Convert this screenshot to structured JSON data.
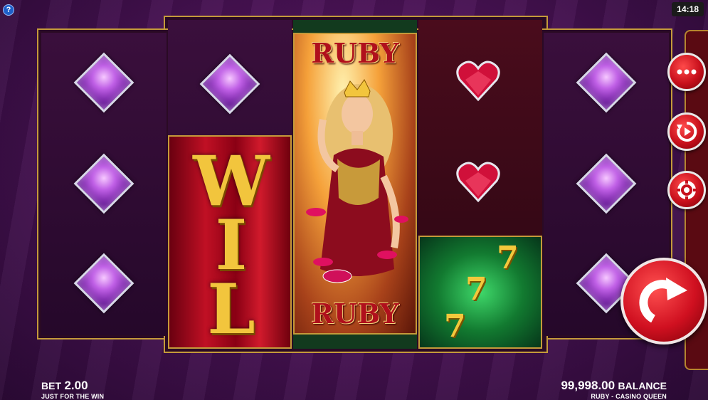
{
  "status": {
    "help_label": "?",
    "clock": "14:18"
  },
  "reels": {
    "reel1": [
      "purple-gem",
      "purple-gem",
      "purple-gem"
    ],
    "reel2": [
      "purple-gem",
      "wild-stack"
    ],
    "reel3": [
      "ruby-queen-stack"
    ],
    "reel4": [
      "ruby-heart",
      "ruby-heart",
      "lucky-sevens"
    ],
    "reel5": [
      "purple-gem",
      "purple-gem",
      "purple-gem"
    ]
  },
  "symbols": {
    "wild_letters": [
      "W",
      "I",
      "L"
    ],
    "queen_top": "RUBY",
    "queen_bottom": "RUBY",
    "sevens": [
      "7",
      "7",
      "7"
    ]
  },
  "controls": {
    "menu_icon": "more-dots-icon",
    "autoplay_icon": "autoplay-icon",
    "bet_icon": "chip-icon",
    "spin_icon": "spin-arrow-icon"
  },
  "footer": {
    "bet_label": "BET",
    "bet_value": "2.00",
    "bet_sub": "JUST FOR THE WIN",
    "balance_value": "99,998.00",
    "balance_label": "BALANCE",
    "game_sub": "RUBY - CASINO QUEEN"
  },
  "colors": {
    "frame_gold": "#c49a3a",
    "button_red": "#c8101c",
    "background_purple": "#4a1256"
  }
}
